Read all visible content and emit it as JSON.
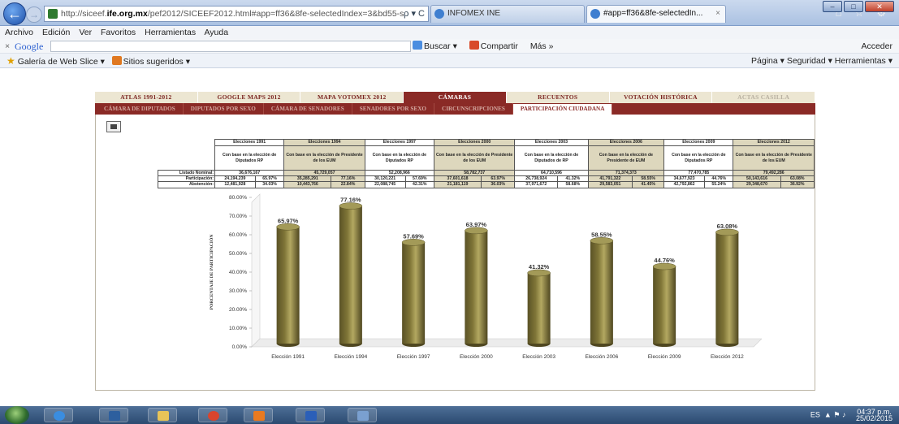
{
  "browser": {
    "url_domain": "ife.org.mx",
    "url_pre": "http://siceef.",
    "url_post": "/pef2012/SICEEF2012.html#app=ff36&8fe-selectedIndex=3&bd55-s",
    "url_controls": "ρ ▾ C",
    "tab_inactive": "INFOMEX INE",
    "tab_active": "#app=ff36&8fe-selectedIn...",
    "tab_close": "×",
    "home_star": "⌂ ☆ ⚙"
  },
  "menu": [
    "Archivo",
    "Edición",
    "Ver",
    "Favoritos",
    "Herramientas",
    "Ayuda"
  ],
  "google_toolbar": {
    "close": "×",
    "logo": "Google",
    "search": "Buscar ▾",
    "share": "Compartir",
    "more": "Más »",
    "sign_in": "Acceder"
  },
  "favorites_bar": {
    "webslice": "Galería de Web Slice ▾",
    "suggested": "Sitios sugeridos ▾",
    "tools": "Página ▾   Seguridad ▾   Herramientas ▾"
  },
  "main_tabs": [
    {
      "label": "ATLAS 1991-2012",
      "state": "normal"
    },
    {
      "label": "GOOGLE MAPS 2012",
      "state": "normal"
    },
    {
      "label": "MAPA VOTOMEX 2012",
      "state": "normal"
    },
    {
      "label": "CÁMARAS",
      "state": "active"
    },
    {
      "label": "RECUENTOS",
      "state": "normal"
    },
    {
      "label": "VOTACIÓN HISTÓRICA",
      "state": "normal"
    },
    {
      "label": "ACTAS CASILLA",
      "state": "disabled"
    }
  ],
  "sub_tabs": [
    {
      "label": "CÁMARA DE DIPUTADOS",
      "state": "normal"
    },
    {
      "label": "DIPUTADOS POR SEXO",
      "state": "normal"
    },
    {
      "label": "CÁMARA DE SENADORES",
      "state": "normal"
    },
    {
      "label": "SENADORES POR SEXO",
      "state": "normal"
    },
    {
      "label": "CIRCUNSCRIPCIONES",
      "state": "normal"
    },
    {
      "label": "PARTICIPACIÓN CIUDADANA",
      "state": "active"
    }
  ],
  "table": {
    "row_labels": [
      "Listado Nominal:",
      "Participación:",
      "Abstención:"
    ],
    "columns": [
      {
        "title": "Elecciones 1991",
        "desc": "Con base en la elección de Diputados RP",
        "nominal": "36,676,167",
        "part": "24,194,239",
        "part_pct": "65.97%",
        "abst": "12,481,928",
        "abst_pct": "34.03%"
      },
      {
        "title": "Elecciones 1994",
        "desc": "Con base en la elección de Presidente de los EUM",
        "nominal": "45,729,057",
        "part": "35,285,291",
        "part_pct": "77.16%",
        "abst": "10,443,766",
        "abst_pct": "22.84%"
      },
      {
        "title": "Elecciones 1997",
        "desc": "Con base en la elección de Diputados RP",
        "nominal": "52,208,966",
        "part": "30,120,221",
        "part_pct": "57.69%",
        "abst": "22,088,745",
        "abst_pct": "42.31%"
      },
      {
        "title": "Elecciones 2000",
        "desc": "Con base en la elección de Presidente de los EUM",
        "nominal": "58,782,737",
        "part": "37,601,618",
        "part_pct": "63.97%",
        "abst": "21,181,119",
        "abst_pct": "36.03%"
      },
      {
        "title": "Elecciones 2003",
        "desc": "Con base en la elección de Diputados de RP",
        "nominal": "64,710,596",
        "part": "26,738,924",
        "part_pct": "41.32%",
        "abst": "37,971,672",
        "abst_pct": "58.68%"
      },
      {
        "title": "Elecciones 2006",
        "desc": "Con base en la elección de Presidente de EUM",
        "nominal": "71,374,373",
        "part": "41,791,322",
        "part_pct": "58.55%",
        "abst": "29,583,051",
        "abst_pct": "41.45%"
      },
      {
        "title": "Elecciones 2009",
        "desc": "Con base en la elección de Diputados RP",
        "nominal": "77,470,785",
        "part": "34,677,923",
        "part_pct": "44.76%",
        "abst": "42,792,862",
        "abst_pct": "55.24%"
      },
      {
        "title": "Elecciones 2012",
        "desc": "Con base en la elección de Presidente de los EUM",
        "nominal": "79,492,286",
        "part": "50,143,616",
        "part_pct": "63.08%",
        "abst": "29,348,670",
        "abst_pct": "36.92%"
      }
    ]
  },
  "chart_data": {
    "type": "bar",
    "categories": [
      "Elección 1991",
      "Elección 1994",
      "Elección 1997",
      "Elección 2000",
      "Elección 2003",
      "Elección 2006",
      "Elección 2009",
      "Elección 2012"
    ],
    "values": [
      65.97,
      77.16,
      57.69,
      63.97,
      41.32,
      58.55,
      44.76,
      63.08
    ],
    "labels": [
      "65.97%",
      "77.16%",
      "57.69%",
      "63.97%",
      "41.32%",
      "58.55%",
      "44.76%",
      "63.08%"
    ],
    "ylabel": "PORCENTAJE DE PARTICIPACIÓN",
    "ylim": [
      0,
      80
    ],
    "yticks": [
      "0.00%",
      "10.00%",
      "20.00%",
      "30.00%",
      "40.00%",
      "50.00%",
      "60.00%",
      "70.00%",
      "80.00%"
    ],
    "bar_color": "#7f7537",
    "grid": false
  },
  "taskbar": {
    "lang": "ES",
    "time": "04:37 p.m.",
    "date": "25/02/2015"
  }
}
